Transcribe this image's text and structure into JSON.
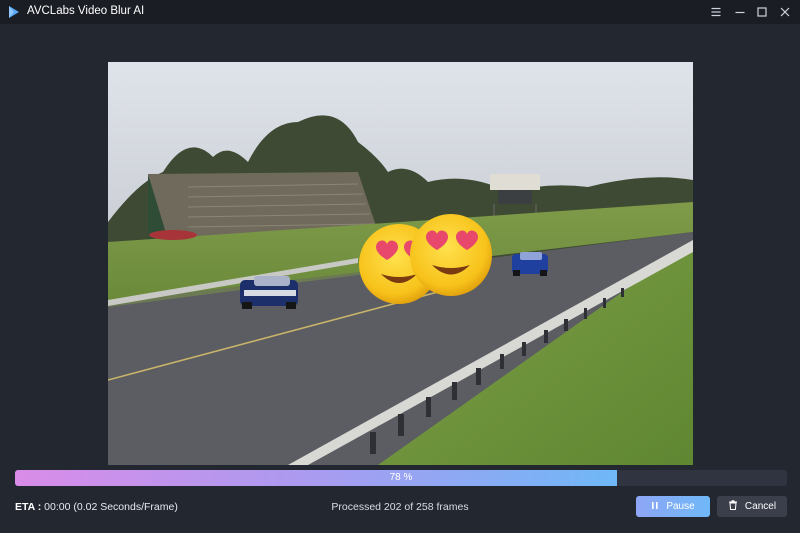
{
  "window": {
    "title": "AVCLabs Video Blur AI",
    "controls": [
      "menu-icon",
      "minimize-icon",
      "maximize-icon",
      "close-icon"
    ]
  },
  "preview": {
    "overlays": [
      "heart-eyes-emoji",
      "heart-eyes-emoji"
    ]
  },
  "progress": {
    "percent": 78,
    "label": "78 %",
    "fill_gradient": [
      "#d98ce8",
      "#6fb8f7"
    ]
  },
  "status": {
    "eta_label": "ETA :",
    "eta_value": "00:00 (0.02 Seconds/Frame)",
    "processed_text": "Processed 202 of 258 frames"
  },
  "buttons": {
    "pause_label": "Pause",
    "cancel_label": "Cancel"
  },
  "colors": {
    "background": "#1e222b",
    "accent": "#6fb8f7"
  }
}
